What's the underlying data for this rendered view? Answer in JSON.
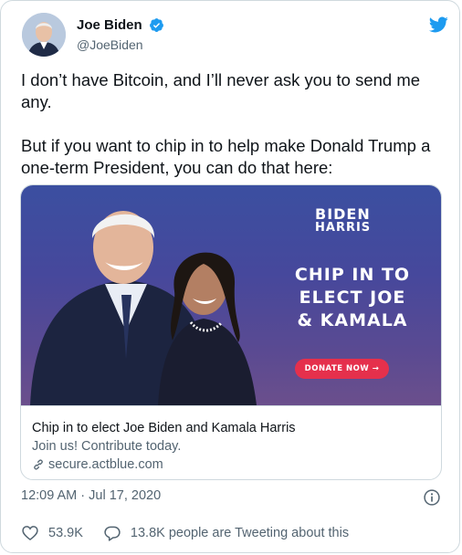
{
  "user": {
    "display_name": "Joe Biden",
    "handle": "@JoeBiden"
  },
  "tweet": {
    "paragraphs": [
      "I don’t have Bitcoin, and I’ll never ask you to send me any.",
      "But if you want to chip in to help make Donald Trump a one-term President, you can do that here:"
    ],
    "timestamp": "12:09 AM · Jul 17, 2020"
  },
  "card": {
    "logo_top": "BIDEN",
    "logo_bottom": "HARRIS",
    "promo_lines": [
      "CHIP IN TO",
      "ELECT JOE",
      "& KAMALA"
    ],
    "donate_label": "DONATE NOW →",
    "title": "Chip in to elect Joe Biden and Kamala Harris",
    "description": "Join us! Contribute today.",
    "domain": "secure.actblue.com"
  },
  "stats": {
    "likes": "53.9K",
    "tweeting": "13.8K people are Tweeting about this"
  },
  "colors": {
    "twitter_blue": "#1d9bf0",
    "donate_red": "#e5304c",
    "secondary_text": "#536471"
  }
}
